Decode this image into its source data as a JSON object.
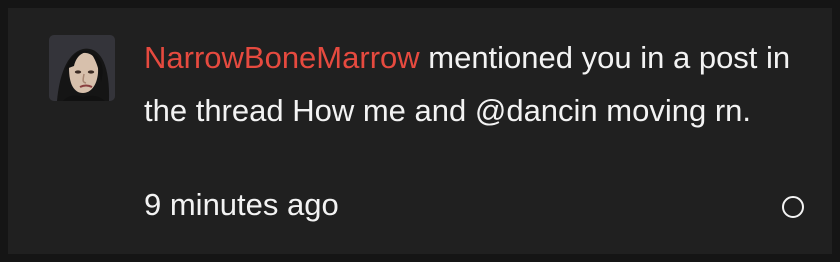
{
  "notification": {
    "avatar": {
      "icon": "user-avatar",
      "background": "#34343a",
      "hair": "#151515",
      "skin": "#d7c0ac"
    },
    "username": "NarrowBoneMarrow",
    "message_text": " mentioned you in a post in the thread How me and @dancin moving rn.",
    "time_ago": "9 minutes ago",
    "status_icon": "unread-circle-icon",
    "colors": {
      "username": "#e64a3f",
      "text": "#f3f3f3",
      "background": "#202020"
    }
  }
}
